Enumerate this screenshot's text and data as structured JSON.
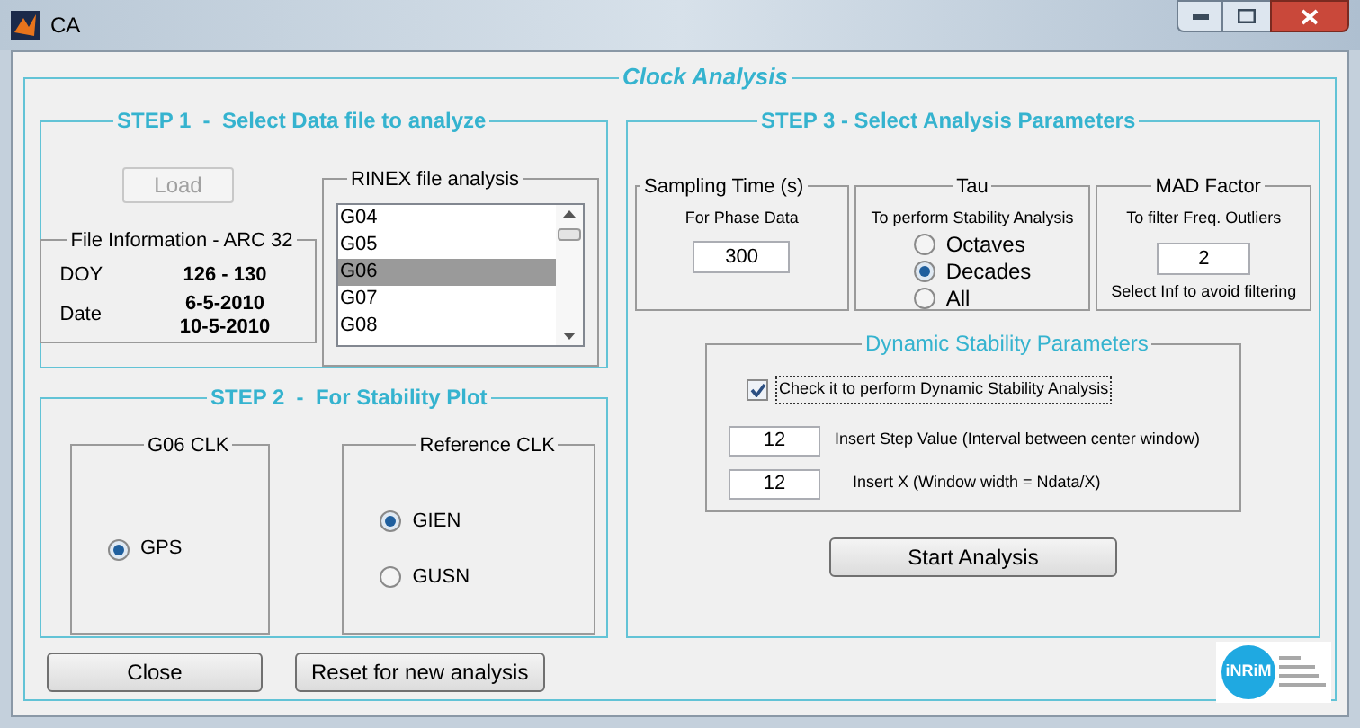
{
  "window": {
    "title": "CA"
  },
  "panel_title": "Clock Analysis",
  "step1": {
    "title": "STEP 1  -  Select Data file to analyze",
    "load_button": {
      "label": "Load",
      "disabled": true
    },
    "file_info": {
      "title": "File Information - ARC 32",
      "rows": [
        {
          "label": "DOY",
          "values": [
            "126 - 130"
          ]
        },
        {
          "label": "Date",
          "values": [
            "6-5-2010",
            "10-5-2010"
          ]
        }
      ]
    },
    "rinex": {
      "title": "RINEX file analysis",
      "items": [
        {
          "label": "G04",
          "selected": false
        },
        {
          "label": "G05",
          "selected": false
        },
        {
          "label": "G06",
          "selected": true
        },
        {
          "label": "G07",
          "selected": false
        },
        {
          "label": "G08",
          "selected": false
        }
      ]
    }
  },
  "step2": {
    "title": "STEP 2  -  For Stability Plot",
    "groups": [
      {
        "title": "G06 CLK",
        "options": [
          {
            "label": "GPS",
            "selected": true
          }
        ]
      },
      {
        "title": "Reference CLK",
        "options": [
          {
            "label": "GIEN",
            "selected": true
          },
          {
            "label": "GUSN",
            "selected": false
          }
        ]
      }
    ]
  },
  "step3": {
    "title": "STEP 3 - Select Analysis Parameters",
    "sampling": {
      "title": "Sampling Time (s)",
      "subtitle": "For Phase Data",
      "value": "300"
    },
    "tau": {
      "title": "Tau",
      "subtitle": "To perform Stability Analysis",
      "options": [
        {
          "label": "Octaves",
          "selected": false
        },
        {
          "label": "Decades",
          "selected": true
        },
        {
          "label": "All",
          "selected": false
        }
      ]
    },
    "mad": {
      "title": "MAD Factor",
      "subtitle": "To filter Freq. Outliers",
      "value": "2",
      "hint": "Select Inf to avoid filtering"
    },
    "dynamic": {
      "title": "Dynamic Stability Parameters",
      "checkbox": {
        "label": "Check it to perform Dynamic Stability Analysis",
        "checked": true
      },
      "fields": [
        {
          "value": "12",
          "label": "Insert Step Value (Interval between center window)"
        },
        {
          "value": "12",
          "label": "Insert X (Window width = Ndata/X)"
        }
      ]
    },
    "start_button": "Start Analysis"
  },
  "buttons": [
    "Close",
    "Reset for new analysis"
  ],
  "logo": {
    "text": "iNRiM"
  }
}
